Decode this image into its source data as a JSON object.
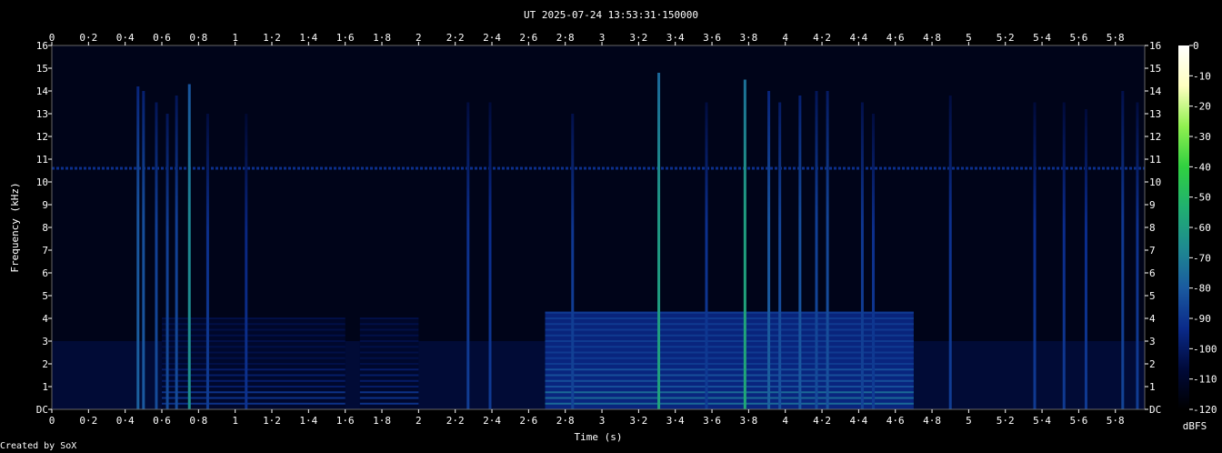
{
  "chart_data": {
    "type": "heatmap",
    "title": "UT 2025-07-24 13:53:31·150000",
    "xlabel": "Time (s)",
    "ylabel": "Frequency (kHz)",
    "colorbar_label": "dBFS",
    "credit": "Created by SoX",
    "xlim": [
      0,
      5.96
    ],
    "ylim": [
      0,
      16
    ],
    "x_ticks": [
      "0",
      "0·2",
      "0·4",
      "0·6",
      "0·8",
      "1",
      "1·2",
      "1·4",
      "1·6",
      "1·8",
      "2",
      "2·2",
      "2·4",
      "2·6",
      "2·8",
      "3",
      "3·2",
      "3·4",
      "3·6",
      "3·8",
      "4",
      "4·2",
      "4·4",
      "4·6",
      "4·8",
      "5",
      "5·2",
      "5·4",
      "5·6",
      "5·8"
    ],
    "y_ticks": [
      "DC",
      "1",
      "2",
      "3",
      "4",
      "5",
      "6",
      "7",
      "8",
      "9",
      "10",
      "11",
      "12",
      "13",
      "14",
      "15",
      "16"
    ],
    "colorbar_ticks": [
      "0",
      "-10",
      "-20",
      "-30",
      "-40",
      "-50",
      "-60",
      "-70",
      "-80",
      "-90",
      "-100",
      "-110",
      "-120"
    ],
    "colorbar_range": [
      -120,
      0
    ],
    "colorbar_colors": [
      "#000000",
      "#000a3a",
      "#0a2a8a",
      "#1a5aa0",
      "#1e8a90",
      "#20b070",
      "#30d040",
      "#90f050",
      "#ffffc0",
      "#ffffff"
    ],
    "background_level_dbfs": -110,
    "steady_tone": {
      "freq_khz": 10.6,
      "level_dbfs": -92
    },
    "wideband_bursts": [
      {
        "time_s": 0.47,
        "top_khz": 14.2,
        "level_dbfs": -82
      },
      {
        "time_s": 0.5,
        "top_khz": 14.0,
        "level_dbfs": -84
      },
      {
        "time_s": 0.57,
        "top_khz": 13.5,
        "level_dbfs": -88
      },
      {
        "time_s": 0.63,
        "top_khz": 13.0,
        "level_dbfs": -88
      },
      {
        "time_s": 0.68,
        "top_khz": 13.8,
        "level_dbfs": -88
      },
      {
        "time_s": 0.75,
        "top_khz": 14.3,
        "level_dbfs": -68
      },
      {
        "time_s": 0.85,
        "top_khz": 13.0,
        "level_dbfs": -92
      },
      {
        "time_s": 1.06,
        "top_khz": 13.0,
        "level_dbfs": -95
      },
      {
        "time_s": 2.27,
        "top_khz": 13.5,
        "level_dbfs": -92
      },
      {
        "time_s": 2.39,
        "top_khz": 13.5,
        "level_dbfs": -93
      },
      {
        "time_s": 2.84,
        "top_khz": 13.0,
        "level_dbfs": -90
      },
      {
        "time_s": 3.31,
        "top_khz": 14.8,
        "level_dbfs": -62
      },
      {
        "time_s": 3.57,
        "top_khz": 13.5,
        "level_dbfs": -92
      },
      {
        "time_s": 3.78,
        "top_khz": 14.5,
        "level_dbfs": -60
      },
      {
        "time_s": 3.91,
        "top_khz": 14.0,
        "level_dbfs": -82
      },
      {
        "time_s": 3.97,
        "top_khz": 13.5,
        "level_dbfs": -86
      },
      {
        "time_s": 4.08,
        "top_khz": 13.8,
        "level_dbfs": -84
      },
      {
        "time_s": 4.17,
        "top_khz": 14.0,
        "level_dbfs": -88
      },
      {
        "time_s": 4.23,
        "top_khz": 14.0,
        "level_dbfs": -86
      },
      {
        "time_s": 4.42,
        "top_khz": 13.5,
        "level_dbfs": -90
      },
      {
        "time_s": 4.48,
        "top_khz": 13.0,
        "level_dbfs": -92
      },
      {
        "time_s": 4.9,
        "top_khz": 13.8,
        "level_dbfs": -92
      },
      {
        "time_s": 5.36,
        "top_khz": 13.5,
        "level_dbfs": -93
      },
      {
        "time_s": 5.52,
        "top_khz": 13.5,
        "level_dbfs": -93
      },
      {
        "time_s": 5.64,
        "top_khz": 13.2,
        "level_dbfs": -93
      },
      {
        "time_s": 5.84,
        "top_khz": 14.0,
        "level_dbfs": -90
      },
      {
        "time_s": 5.92,
        "top_khz": 13.5,
        "level_dbfs": -92
      }
    ],
    "harmonic_blocks": [
      {
        "start_s": 2.69,
        "end_s": 4.7,
        "top_khz": 4.3,
        "level_dbfs": -88
      },
      {
        "start_s": 0.6,
        "end_s": 1.6,
        "top_khz": 4.0,
        "level_dbfs": -104
      },
      {
        "start_s": 1.68,
        "end_s": 2.0,
        "top_khz": 4.0,
        "level_dbfs": -104
      }
    ]
  }
}
